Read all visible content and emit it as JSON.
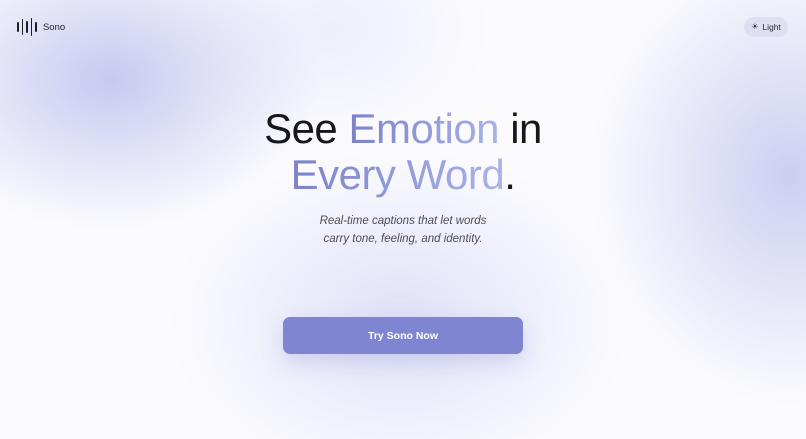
{
  "brand": {
    "name": "Sono",
    "icon": "soundwave-bars-icon"
  },
  "theme_toggle": {
    "icon": "sun-icon",
    "icon_glyph": "☀",
    "label": "Light"
  },
  "hero": {
    "headline": {
      "line1_plain_a": "See",
      "line1_highlight": "Emotion",
      "line1_plain_b": "in",
      "line2_highlight": "Every Word",
      "line2_punct": "."
    },
    "subtitle_line1": "Real-time captions that let words",
    "subtitle_line2": "carry tone, feeling, and identity.",
    "cta_label": "Try Sono Now"
  },
  "colors": {
    "accent": "#7e86d2",
    "gradient_start": "#7c82c8",
    "gradient_end": "#a9b2ea",
    "text": "#16161b"
  }
}
